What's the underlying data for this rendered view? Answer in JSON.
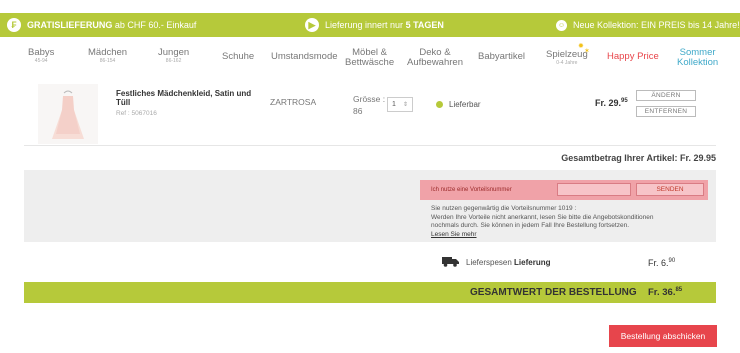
{
  "colors": {
    "accent_green": "#b6c93a",
    "accent_red": "#e7454c",
    "accent_blue": "#3fa9c9"
  },
  "promo": {
    "free_shipping_strong": "GRATISLIEFERUNG",
    "free_shipping_rest": " ab CHF 60.- Einkauf",
    "delivery_text": "Lieferung innert nur ",
    "delivery_days": "5 TAGEN",
    "new_collection": "Neue Kollektion: EIN PREIS bis 14 Jahre!"
  },
  "nav": {
    "babys": "Babys",
    "babys_sub": "45-94",
    "maedchen": "Mädchen",
    "maedchen_sub": "86-154",
    "jungen": "Jungen",
    "jungen_sub": "86-162",
    "schuhe": "Schuhe",
    "umstandsmode": "Umstandsmode",
    "moebel_1": "Möbel &",
    "moebel_2": "Bettwäsche",
    "deko_1": "Deko &",
    "deko_2": "Aufbewahren",
    "babyartikel": "Babyartikel",
    "spielzeug": "Spielzeug",
    "spielzeug_sub": "0-4 Jahre",
    "happy_price": "Happy Price",
    "sommer_1": "Sommer",
    "sommer_2": "Kollektion"
  },
  "cart_item": {
    "name": "Festliches Mädchenkleid, Satin und Tüll",
    "ref": "Ref : 5067016",
    "color": "ZARTROSA",
    "size_label": "Grösse :",
    "size_value": "86",
    "quantity": "1",
    "stock_status": "Lieferbar",
    "price_main": "Fr. 29.",
    "price_cents": "95",
    "change_label": "ÄNDERN",
    "remove_label": "ENTFERNEN"
  },
  "subtotal": "Gesamtbetrag Ihrer Artikel: Fr. 29.95",
  "voucher": {
    "label": "Ich nutze eine Vorteilsnummer",
    "input_value": "",
    "send_label": "SENDEN",
    "info_line1": "Sie nutzen gegenwärtig die Vorteilsnummer 1019 :",
    "info_line2": "Werden Ihre Vorteile nicht anerkannt, lesen Sie bitte die Angebotskonditionen",
    "info_line3": "nochmals durch. Sie können in jedem Fall Ihre Bestellung fortsetzen.",
    "read_more": "Lesen Sie mehr"
  },
  "shipping": {
    "label": "Lieferspesen ",
    "label_bold": "Lieferung",
    "amount_main": "Fr. 6.",
    "amount_cents": "90"
  },
  "grand_total": {
    "label": "GESAMTWERT DER BESTELLUNG",
    "amount_main": "Fr. 36.",
    "amount_cents": "85"
  },
  "submit_label": "Bestellung abschicken"
}
